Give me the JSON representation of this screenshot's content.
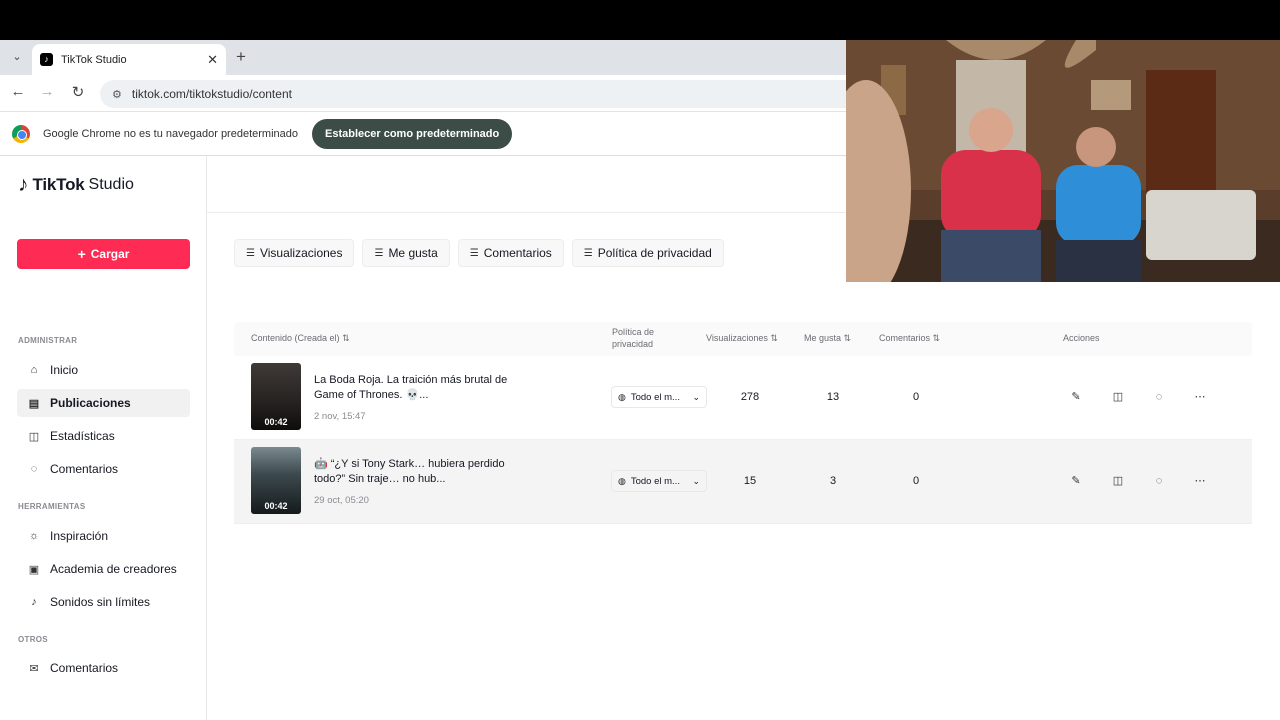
{
  "browser": {
    "tab_title": "TikTok Studio",
    "url": "tiktok.com/tiktokstudio/content",
    "infobar_text": "Google Chrome no es tu navegador predeterminado",
    "infobar_button": "Establecer como predeterminado"
  },
  "sidebar": {
    "logo_brand": "TikTok",
    "logo_sub": "Studio",
    "upload_label": "Cargar",
    "sections": {
      "admin": "ADMINISTRAR",
      "tools": "HERRAMIENTAS",
      "others": "OTROS"
    },
    "items": {
      "inicio": "Inicio",
      "publicaciones": "Publicaciones",
      "estadisticas": "Estadísticas",
      "comentarios": "Comentarios",
      "inspiracion": "Inspiración",
      "academia": "Academia de creadores",
      "sonidos": "Sonidos sin límites",
      "comentarios2": "Comentarios"
    }
  },
  "filters": [
    "Visualizaciones",
    "Me gusta",
    "Comentarios",
    "Política de privacidad"
  ],
  "table": {
    "headers": {
      "content": "Contenido (Creada el)",
      "privacy": "Política de privacidad",
      "views": "Visualizaciones",
      "likes": "Me gusta",
      "comments": "Comentarios",
      "actions": "Acciones"
    },
    "rows": [
      {
        "duration": "00:42",
        "title": "La Boda Roja. La traición más brutal de Game of Thrones. 💀...",
        "date": "2 nov, 15:47",
        "privacy": "Todo el m...",
        "views": "278",
        "likes": "13",
        "comments": "0"
      },
      {
        "duration": "00:42",
        "title": "🤖 “¿Y si Tony Stark… hubiera perdido todo?” Sin traje… no hub...",
        "date": "29 oct, 05:20",
        "privacy": "Todo el m...",
        "views": "15",
        "likes": "3",
        "comments": "0"
      }
    ]
  },
  "colors": {
    "brand": "#fe2c55",
    "infobar_button": "#3c4d47"
  }
}
